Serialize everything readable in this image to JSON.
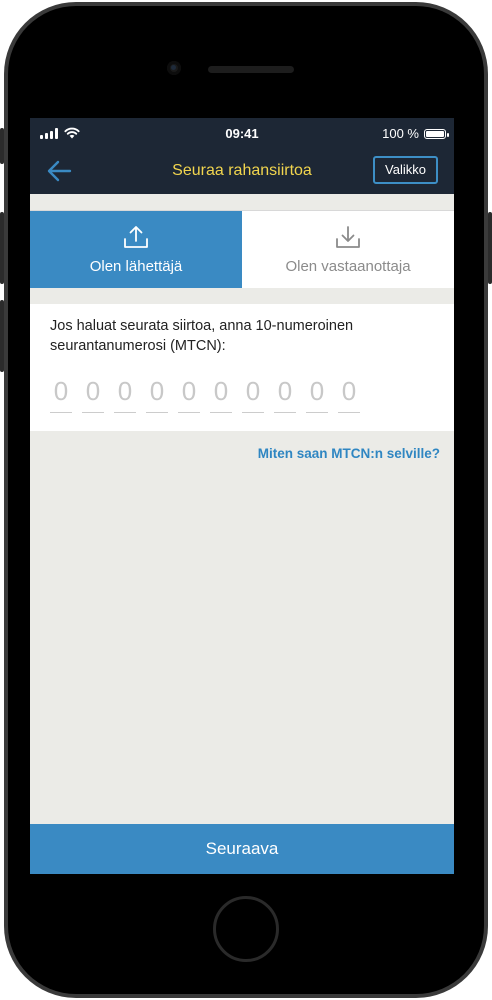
{
  "status_bar": {
    "time": "09:41",
    "battery": "100 %"
  },
  "nav": {
    "title": "Seuraa rahansiirtoa",
    "menu_label": "Valikko"
  },
  "toggle": [
    {
      "label": "Olen lähettäjä",
      "icon": "upload-icon",
      "active": true
    },
    {
      "label": "Olen vastaanottaja",
      "icon": "download-icon",
      "active": false
    }
  ],
  "form": {
    "prompt": "Jos haluat seurata siirtoa, anna 10-numeroinen seurantanumerosi (MTCN):",
    "digits": [
      "0",
      "0",
      "0",
      "0",
      "0",
      "0",
      "0",
      "0",
      "0",
      "0"
    ]
  },
  "help_link": "Miten saan MTCN:n selville?",
  "next_button": "Seuraava",
  "colors": {
    "header_bg": "#1d2735",
    "title": "#f1d54e",
    "accent": "#3a8ac3",
    "link": "#2f86c2"
  }
}
